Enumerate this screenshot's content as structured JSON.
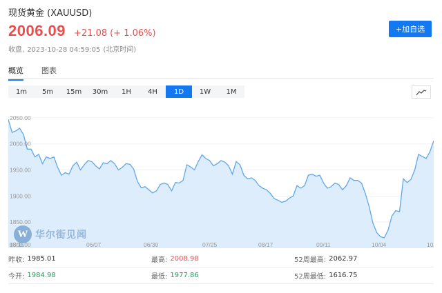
{
  "header": {
    "title": "现货黄金 (XAUUSD)",
    "price": "2006.09",
    "change": "+21.08",
    "change_pct": "(+ 1.06%)",
    "status_label": "收盘,",
    "timestamp": "2023-10-28 04:59:05",
    "timezone": "(北京时间)"
  },
  "actions": {
    "add_watchlist": "+加自选"
  },
  "tabs": [
    {
      "label": "概览",
      "active": true
    },
    {
      "label": "图表",
      "active": false
    }
  ],
  "periods": [
    {
      "label": "1m",
      "active": false
    },
    {
      "label": "5m",
      "active": false
    },
    {
      "label": "15m",
      "active": false
    },
    {
      "label": "30m",
      "active": false
    },
    {
      "label": "1H",
      "active": false
    },
    {
      "label": "4H",
      "active": false
    },
    {
      "label": "1D",
      "active": true
    },
    {
      "label": "1W",
      "active": false
    },
    {
      "label": "1M",
      "active": false
    }
  ],
  "chart_type_icon": "line-chart-icon",
  "watermark": {
    "logo": "W",
    "text": "华尔街见闻"
  },
  "colors": {
    "accent": "#1478f0",
    "up": "#e8504f",
    "down": "#1aa05a",
    "line": "#5ea7ec",
    "fill": "#deedfb"
  },
  "chart_data": {
    "type": "area",
    "ylim": [
      1800,
      2075
    ],
    "yticks": [
      "2050.00",
      "2000.00",
      "1950.00",
      "1900.00",
      "1850.00",
      "1800.00"
    ],
    "xticks": [
      "05/15",
      "06/07",
      "06/30",
      "07/25",
      "08/17",
      "09/11",
      "10/04",
      "10/2"
    ],
    "values": [
      2047,
      2022,
      2025,
      2030,
      2018,
      1990,
      1990,
      1975,
      1980,
      1962,
      1975,
      1972,
      1975,
      1955,
      1940,
      1945,
      1942,
      1958,
      1965,
      1950,
      1960,
      1968,
      1966,
      1958,
      1952,
      1964,
      1962,
      1968,
      1962,
      1950,
      1955,
      1962,
      1961,
      1952,
      1928,
      1916,
      1918,
      1912,
      1906,
      1910,
      1922,
      1925,
      1922,
      1910,
      1926,
      1925,
      1930,
      1960,
      1956,
      1950,
      1966,
      1979,
      1972,
      1968,
      1958,
      1962,
      1968,
      1965,
      1958,
      1942,
      1966,
      1960,
      1940,
      1933,
      1935,
      1930,
      1920,
      1915,
      1912,
      1905,
      1895,
      1892,
      1888,
      1890,
      1896,
      1900,
      1920,
      1915,
      1920,
      1940,
      1942,
      1938,
      1940,
      1925,
      1915,
      1918,
      1925,
      1922,
      1912,
      1920,
      1935,
      1930,
      1930,
      1925,
      1905,
      1880,
      1848,
      1830,
      1822,
      1820,
      1835,
      1862,
      1872,
      1870,
      1933,
      1926,
      1932,
      1950,
      1980,
      1976,
      1972,
      1985,
      2006
    ]
  },
  "stats": {
    "prev_close_label": "昨收:",
    "prev_close": "1985.01",
    "high_label": "最高:",
    "high": "2008.98",
    "high52_label": "52周最高:",
    "high52": "2062.97",
    "open_label": "今开:",
    "open": "1984.98",
    "low_label": "最低:",
    "low": "1977.86",
    "low52_label": "52周最低:",
    "low52": "1616.75"
  }
}
